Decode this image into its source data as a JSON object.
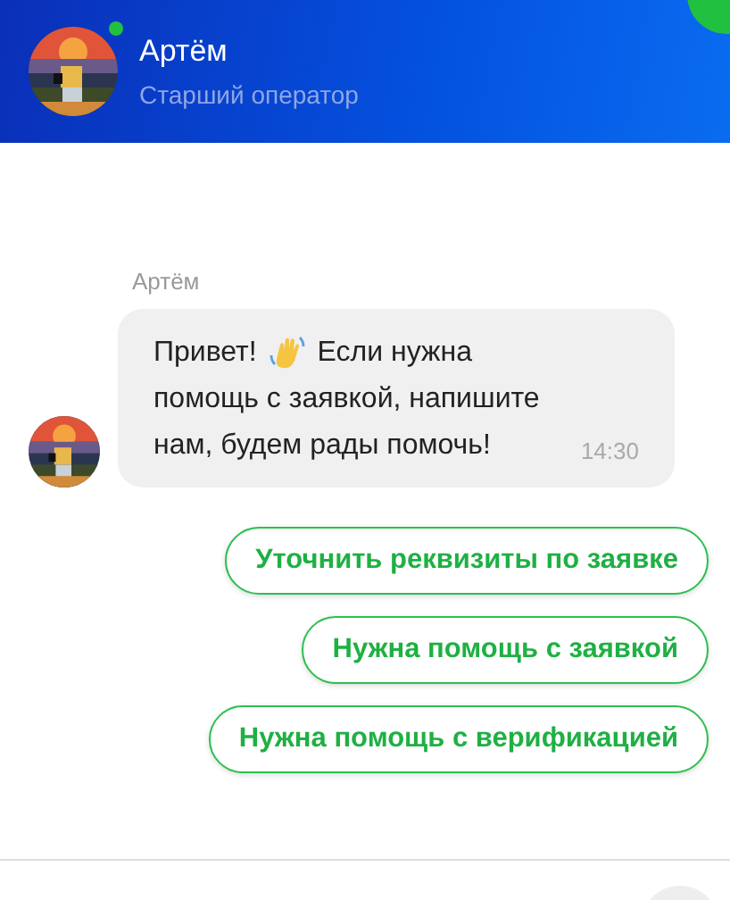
{
  "header": {
    "name": "Артём",
    "role": "Старший оператор",
    "online": true
  },
  "messages": [
    {
      "sender": "Артём",
      "text_before": "Привет!",
      "text_mid": "Если нужна",
      "text_after": "помощь с заявкой, напишите нам, будем рады помочь!",
      "time": "14:30"
    }
  ],
  "quick_replies": [
    "Уточнить реквизиты по заявке",
    "Нужна помощь с заявкой",
    "Нужна помощь с верификацией"
  ]
}
